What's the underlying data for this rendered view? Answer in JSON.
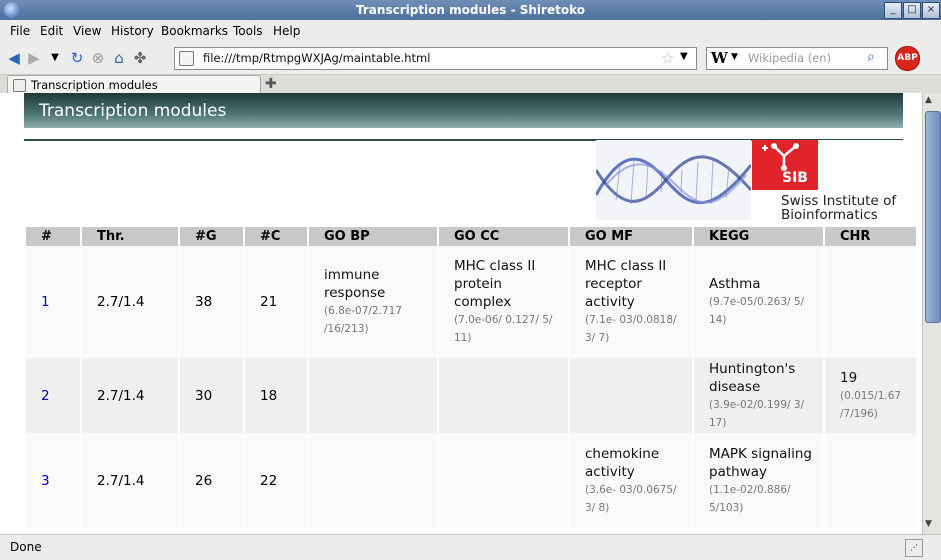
{
  "window": {
    "title": "Transcription modules - Shiretoko"
  },
  "menu": [
    "File",
    "Edit",
    "View",
    "History",
    "Bookmarks",
    "Tools",
    "Help"
  ],
  "nav": {
    "url": "file:///tmp/RtmpgWXJAg/maintable.html",
    "search_engine": "W",
    "search_placeholder": "Wikipedia (en)",
    "adblock_label": "ABP"
  },
  "tabs": [
    {
      "label": "Transcription modules"
    }
  ],
  "page": {
    "heading": "Transcription modules",
    "logo": {
      "sib_abbrev": "SIB",
      "name_line1": "Swiss Institute of",
      "name_line2": "Bioinformatics"
    }
  },
  "table": {
    "columns": [
      "#",
      "Thr.",
      "#G",
      "#C",
      "GO BP",
      "GO CC",
      "GO MF",
      "KEGG",
      "CHR"
    ],
    "rows": [
      {
        "idx": "1",
        "thr": "2.7/1.4",
        "g": "38",
        "c": "21",
        "bp_term": "immune response",
        "bp_stat": "(6.8e-07/2.717 /16/213)",
        "cc_term": "MHC class II protein complex",
        "cc_stat": "(7.0e-06/ 0.127/ 5/ 11)",
        "mf_term": "MHC class II receptor activity",
        "mf_stat": "(7.1e- 03/0.0818/ 3/ 7)",
        "kegg_term": "Asthma",
        "kegg_stat": "(9.7e-05/0.263/ 5/ 14)",
        "chr_term": "",
        "chr_stat": ""
      },
      {
        "idx": "2",
        "thr": "2.7/1.4",
        "g": "30",
        "c": "18",
        "bp_term": "",
        "bp_stat": "",
        "cc_term": "",
        "cc_stat": "",
        "mf_term": "",
        "mf_stat": "",
        "kegg_term": "Huntington's disease",
        "kegg_stat": "(3.9e-02/0.199/ 3/ 17)",
        "chr_term": "19",
        "chr_stat": "(0.015/1.67 /7/196)"
      },
      {
        "idx": "3",
        "thr": "2.7/1.4",
        "g": "26",
        "c": "22",
        "bp_term": "",
        "bp_stat": "",
        "cc_term": "",
        "cc_stat": "",
        "mf_term": "chemokine activity",
        "mf_stat": "(3.6e- 03/0.0675/ 3/ 8)",
        "kegg_term": "MAPK signaling pathway",
        "kegg_stat": "(1.1e-02/0.886/ 5/103)",
        "chr_term": "",
        "chr_stat": ""
      }
    ]
  },
  "status": {
    "text": "Done"
  }
}
